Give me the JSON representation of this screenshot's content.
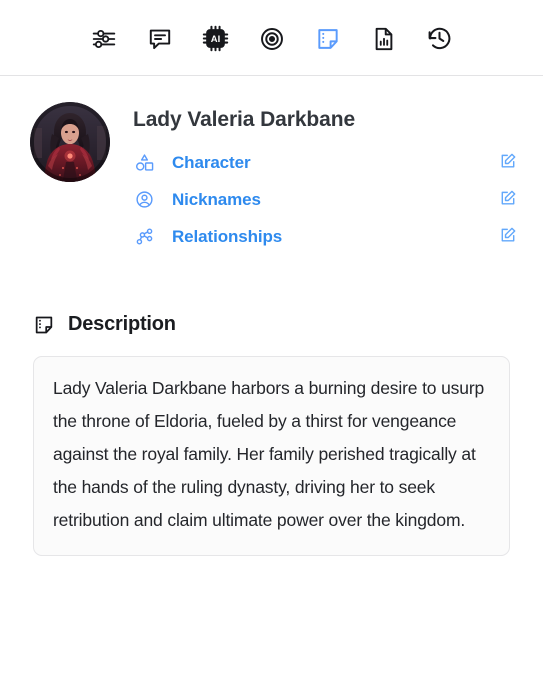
{
  "toolbar": {
    "items": [
      {
        "name": "sliders-icon",
        "label": "Attributes",
        "active": false
      },
      {
        "name": "chat-bubble-icon",
        "label": "Chat",
        "active": false
      },
      {
        "name": "ai-chip-icon",
        "label": "AI",
        "active": false
      },
      {
        "name": "target-icon",
        "label": "Goals",
        "active": false
      },
      {
        "name": "sticky-note-icon",
        "label": "Description",
        "active": true
      },
      {
        "name": "document-chart-icon",
        "label": "Report",
        "active": false
      },
      {
        "name": "history-icon",
        "label": "History",
        "active": false
      }
    ]
  },
  "entity": {
    "title": "Lady Valeria Darkbane",
    "avatar_alt": "Lady Valeria Darkbane portrait",
    "attributes": [
      {
        "icon": "shapes-icon",
        "label": "Character",
        "edit_icon": "edit-square-icon"
      },
      {
        "icon": "user-circle-icon",
        "label": "Nicknames",
        "edit_icon": "edit-square-icon"
      },
      {
        "icon": "network-nodes-icon",
        "label": "Relationships",
        "edit_icon": "edit-square-icon"
      }
    ]
  },
  "description": {
    "heading": "Description",
    "heading_icon": "sticky-note-icon",
    "body": "Lady Valeria Darkbane harbors a burning desire to usurp the throne of Eldoria, fueled by a thirst for vengeance against the royal family. Her family perished tragically at the hands of the ruling dynasty, driving her to seek retribution and claim ultimate power over the kingdom."
  },
  "colors": {
    "link_blue": "#2e8aee",
    "icon_blue": "#5a9bfc",
    "text_dark": "#24262b",
    "title_gray": "#33373d",
    "border_gray": "#e6e6e8",
    "panel_bg": "#fbfbfb"
  }
}
